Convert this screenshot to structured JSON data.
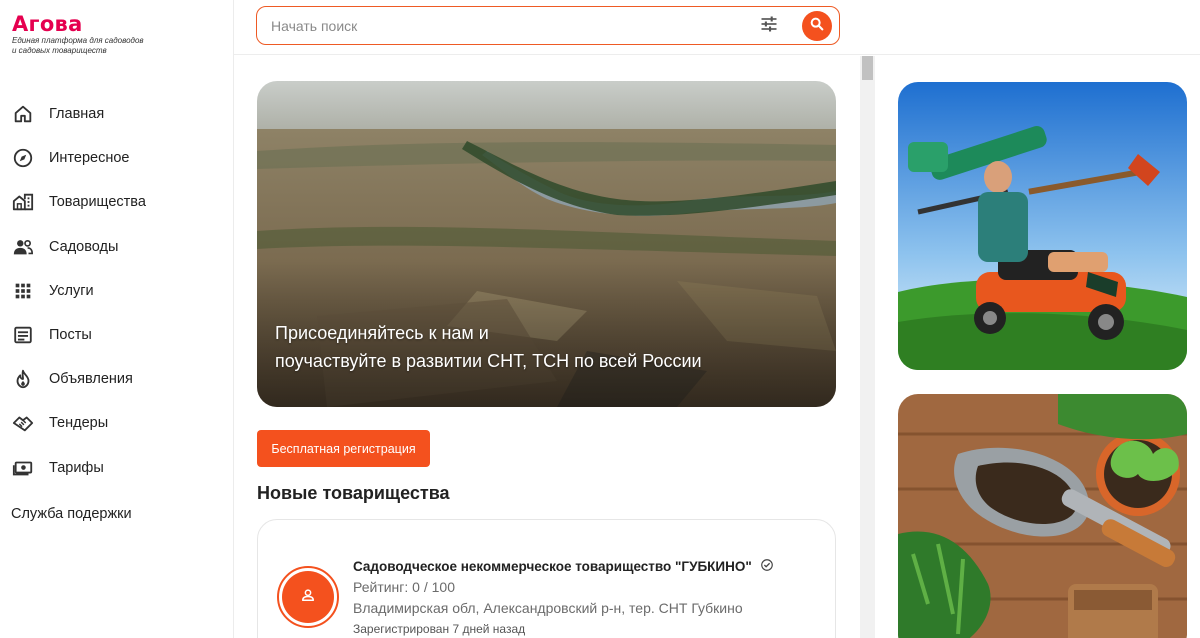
{
  "brand": {
    "name": "Агова",
    "tagline_line1": "Единая платформа для садоводов",
    "tagline_line2": "и садовых товариществ",
    "accent": "#e5004f",
    "primary": "#f4511e"
  },
  "search": {
    "placeholder": "Начать поиск",
    "filter_icon": "tune-icon",
    "search_icon": "search-icon"
  },
  "sidebar": {
    "items": [
      {
        "label": "Главная",
        "icon": "home-icon"
      },
      {
        "label": "Интересное",
        "icon": "compass-icon"
      },
      {
        "label": "Товарищества",
        "icon": "buildings-icon"
      },
      {
        "label": "Садоводы",
        "icon": "people-icon"
      },
      {
        "label": "Услуги",
        "icon": "grid-icon"
      },
      {
        "label": "Посты",
        "icon": "article-icon"
      },
      {
        "label": "Объявления",
        "icon": "fire-icon"
      },
      {
        "label": "Тендеры",
        "icon": "handshake-icon"
      },
      {
        "label": "Тарифы",
        "icon": "money-icon"
      }
    ],
    "support_label": "Служба подержки"
  },
  "hero": {
    "line1": "Присоединяйтесь к нам и",
    "line2": "поучаствуйте в развитии СНТ, ТСН по всей России"
  },
  "register_button": "Бесплатная регистрация",
  "section_title": "Новые товарищества",
  "card": {
    "title": "Садоводческое некоммерческое товарищество \"ГУБКИНО\"",
    "rating": "Рейтинг: 0 / 100",
    "location": "Владимирская обл, Александровский р-н, тер. СНТ Губкино",
    "registered": "Зарегистрирован 7 дней назад"
  }
}
